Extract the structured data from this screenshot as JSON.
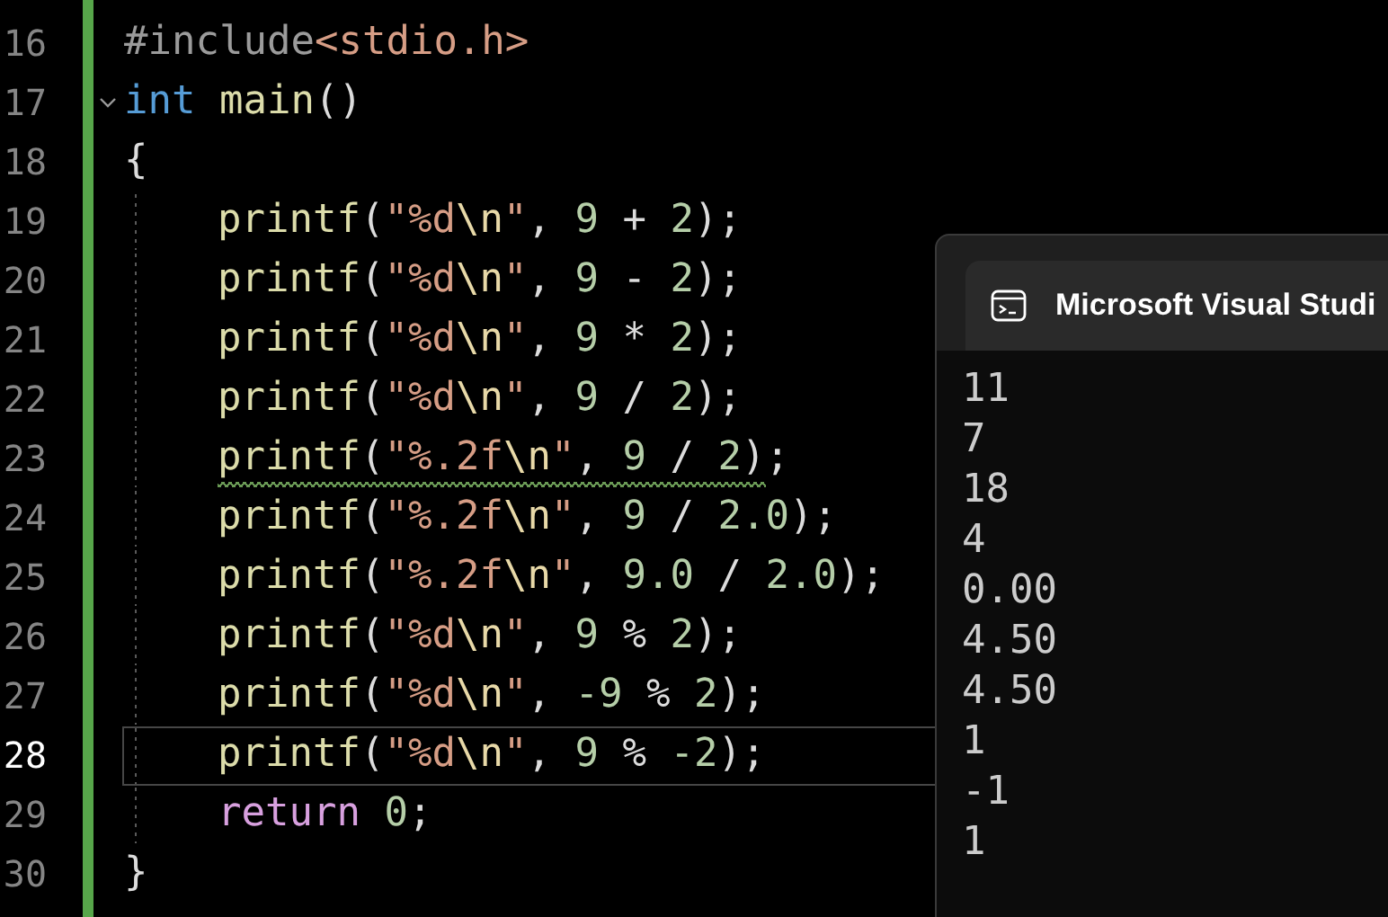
{
  "editor": {
    "lines": [
      {
        "number": "16",
        "current": false,
        "fold": false,
        "warning": false,
        "tokens": [
          {
            "kind": "preproc",
            "text": "#include"
          },
          {
            "kind": "string",
            "text": "<stdio.h>"
          }
        ]
      },
      {
        "number": "17",
        "current": false,
        "fold": true,
        "warning": false,
        "tokens": [
          {
            "kind": "keyword",
            "text": "int"
          },
          {
            "kind": "func",
            "text": " main"
          },
          {
            "kind": "punct",
            "text": "()"
          }
        ]
      },
      {
        "number": "18",
        "current": false,
        "fold": false,
        "warning": false,
        "tokens": [
          {
            "kind": "punct",
            "text": "{"
          }
        ],
        "children": [
          {
            "number": "19",
            "current": false,
            "fold": false,
            "warning": false,
            "tokens": [
              {
                "kind": "func",
                "text": "printf"
              },
              {
                "kind": "punct",
                "text": "("
              },
              {
                "kind": "string",
                "text": "\"%d"
              },
              {
                "kind": "escape",
                "text": "\\n"
              },
              {
                "kind": "string",
                "text": "\""
              },
              {
                "kind": "punct",
                "text": ", "
              },
              {
                "kind": "number",
                "text": "9"
              },
              {
                "kind": "punct",
                "text": " + "
              },
              {
                "kind": "number",
                "text": "2"
              },
              {
                "kind": "punct",
                "text": ")"
              },
              {
                "kind": "punct",
                "text": ";"
              }
            ]
          },
          {
            "number": "20",
            "current": false,
            "fold": false,
            "warning": false,
            "tokens": [
              {
                "kind": "func",
                "text": "printf"
              },
              {
                "kind": "punct",
                "text": "("
              },
              {
                "kind": "string",
                "text": "\"%d"
              },
              {
                "kind": "escape",
                "text": "\\n"
              },
              {
                "kind": "string",
                "text": "\""
              },
              {
                "kind": "punct",
                "text": ", "
              },
              {
                "kind": "number",
                "text": "9"
              },
              {
                "kind": "punct",
                "text": " - "
              },
              {
                "kind": "number",
                "text": "2"
              },
              {
                "kind": "punct",
                "text": ")"
              },
              {
                "kind": "punct",
                "text": ";"
              }
            ]
          },
          {
            "number": "21",
            "current": false,
            "fold": false,
            "warning": false,
            "tokens": [
              {
                "kind": "func",
                "text": "printf"
              },
              {
                "kind": "punct",
                "text": "("
              },
              {
                "kind": "string",
                "text": "\"%d"
              },
              {
                "kind": "escape",
                "text": "\\n"
              },
              {
                "kind": "string",
                "text": "\""
              },
              {
                "kind": "punct",
                "text": ", "
              },
              {
                "kind": "number",
                "text": "9"
              },
              {
                "kind": "punct",
                "text": " * "
              },
              {
                "kind": "number",
                "text": "2"
              },
              {
                "kind": "punct",
                "text": ")"
              },
              {
                "kind": "punct",
                "text": ";"
              }
            ]
          },
          {
            "number": "22",
            "current": false,
            "fold": false,
            "warning": false,
            "tokens": [
              {
                "kind": "func",
                "text": "printf"
              },
              {
                "kind": "punct",
                "text": "("
              },
              {
                "kind": "string",
                "text": "\"%d"
              },
              {
                "kind": "escape",
                "text": "\\n"
              },
              {
                "kind": "string",
                "text": "\""
              },
              {
                "kind": "punct",
                "text": ", "
              },
              {
                "kind": "number",
                "text": "9"
              },
              {
                "kind": "punct",
                "text": " / "
              },
              {
                "kind": "number",
                "text": "2"
              },
              {
                "kind": "punct",
                "text": ")"
              },
              {
                "kind": "punct",
                "text": ";"
              }
            ]
          },
          {
            "number": "23",
            "current": false,
            "fold": false,
            "warning": true,
            "tokens": [
              {
                "kind": "func",
                "text": "printf"
              },
              {
                "kind": "punct",
                "text": "("
              },
              {
                "kind": "string",
                "text": "\"%.2f"
              },
              {
                "kind": "escape",
                "text": "\\n"
              },
              {
                "kind": "string",
                "text": "\""
              },
              {
                "kind": "punct",
                "text": ", "
              },
              {
                "kind": "number",
                "text": "9"
              },
              {
                "kind": "punct",
                "text": " / "
              },
              {
                "kind": "number",
                "text": "2"
              },
              {
                "kind": "punct",
                "text": ")"
              },
              {
                "kind": "punct",
                "text": ";"
              }
            ]
          },
          {
            "number": "24",
            "current": false,
            "fold": false,
            "warning": false,
            "tokens": [
              {
                "kind": "func",
                "text": "printf"
              },
              {
                "kind": "punct",
                "text": "("
              },
              {
                "kind": "string",
                "text": "\"%.2f"
              },
              {
                "kind": "escape",
                "text": "\\n"
              },
              {
                "kind": "string",
                "text": "\""
              },
              {
                "kind": "punct",
                "text": ", "
              },
              {
                "kind": "number",
                "text": "9"
              },
              {
                "kind": "punct",
                "text": " / "
              },
              {
                "kind": "number",
                "text": "2.0"
              },
              {
                "kind": "punct",
                "text": ")"
              },
              {
                "kind": "punct",
                "text": ";"
              }
            ]
          },
          {
            "number": "25",
            "current": false,
            "fold": false,
            "warning": false,
            "tokens": [
              {
                "kind": "func",
                "text": "printf"
              },
              {
                "kind": "punct",
                "text": "("
              },
              {
                "kind": "string",
                "text": "\"%.2f"
              },
              {
                "kind": "escape",
                "text": "\\n"
              },
              {
                "kind": "string",
                "text": "\""
              },
              {
                "kind": "punct",
                "text": ", "
              },
              {
                "kind": "number",
                "text": "9.0"
              },
              {
                "kind": "punct",
                "text": " / "
              },
              {
                "kind": "number",
                "text": "2.0"
              },
              {
                "kind": "punct",
                "text": ")"
              },
              {
                "kind": "punct",
                "text": ";"
              }
            ]
          },
          {
            "number": "26",
            "current": false,
            "fold": false,
            "warning": false,
            "tokens": [
              {
                "kind": "func",
                "text": "printf"
              },
              {
                "kind": "punct",
                "text": "("
              },
              {
                "kind": "string",
                "text": "\"%d"
              },
              {
                "kind": "escape",
                "text": "\\n"
              },
              {
                "kind": "string",
                "text": "\""
              },
              {
                "kind": "punct",
                "text": ", "
              },
              {
                "kind": "number",
                "text": "9"
              },
              {
                "kind": "punct",
                "text": " % "
              },
              {
                "kind": "number",
                "text": "2"
              },
              {
                "kind": "punct",
                "text": ")"
              },
              {
                "kind": "punct",
                "text": ";"
              }
            ]
          },
          {
            "number": "27",
            "current": false,
            "fold": false,
            "warning": false,
            "tokens": [
              {
                "kind": "func",
                "text": "printf"
              },
              {
                "kind": "punct",
                "text": "("
              },
              {
                "kind": "string",
                "text": "\"%d"
              },
              {
                "kind": "escape",
                "text": "\\n"
              },
              {
                "kind": "string",
                "text": "\""
              },
              {
                "kind": "punct",
                "text": ", "
              },
              {
                "kind": "number",
                "text": "-9"
              },
              {
                "kind": "punct",
                "text": " % "
              },
              {
                "kind": "number",
                "text": "2"
              },
              {
                "kind": "punct",
                "text": ")"
              },
              {
                "kind": "punct",
                "text": ";"
              }
            ]
          },
          {
            "number": "28",
            "current": true,
            "fold": false,
            "warning": false,
            "tokens": [
              {
                "kind": "func",
                "text": "printf"
              },
              {
                "kind": "punct",
                "text": "("
              },
              {
                "kind": "string",
                "text": "\"%d"
              },
              {
                "kind": "escape",
                "text": "\\n"
              },
              {
                "kind": "string",
                "text": "\""
              },
              {
                "kind": "punct",
                "text": ", "
              },
              {
                "kind": "number",
                "text": "9"
              },
              {
                "kind": "punct",
                "text": " % "
              },
              {
                "kind": "number",
                "text": "-2"
              },
              {
                "kind": "punct",
                "text": ")"
              },
              {
                "kind": "punct",
                "text": ";"
              }
            ]
          },
          {
            "number": "29",
            "current": false,
            "fold": false,
            "warning": false,
            "tokens": [
              {
                "kind": "control",
                "text": "return "
              },
              {
                "kind": "number",
                "text": "0"
              },
              {
                "kind": "punct",
                "text": ";"
              }
            ]
          }
        ]
      },
      {
        "number": "30",
        "current": false,
        "fold": false,
        "warning": false,
        "tokens": [
          {
            "kind": "punct",
            "text": "}"
          }
        ]
      }
    ]
  },
  "console": {
    "title": "Microsoft Visual Studi",
    "output": [
      "11",
      "7",
      "18",
      "4",
      "0.00",
      "4.50",
      "4.50",
      "1",
      "-1",
      "1"
    ]
  }
}
